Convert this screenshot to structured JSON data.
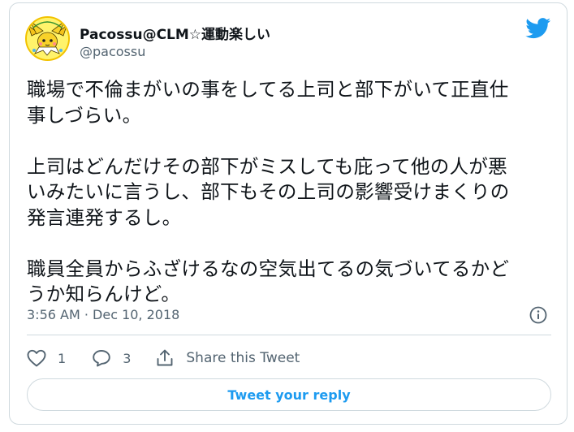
{
  "author": {
    "display_name": "Pacossu@CLM☆運動楽しい",
    "handle": "@pacossu",
    "avatar_icon": "jolteon-avatar-icon"
  },
  "tweet": {
    "text": "職場で不倫まがいの事をしてる上司と部下がいて正直仕\n事しづらい。\n\n上司はどんだけその部下がミスしても庇って他の人が悪\nいみたいに言うし、部下もその上司の影響受けまくりの\n発言連発するし。\n\n職員全員からふざけるなの空気出てるの気づいてるかど\nうか知らんけど。",
    "timestamp": "3:56 AM · Dec 10, 2018"
  },
  "actions": {
    "like_count": "1",
    "reply_count": "3",
    "share_label": "Share this Tweet"
  },
  "reply_button": {
    "label": "Tweet your reply"
  },
  "colors": {
    "brand_blue": "#1d9bf0",
    "secondary_text": "#536471",
    "border": "#cfd9de"
  }
}
